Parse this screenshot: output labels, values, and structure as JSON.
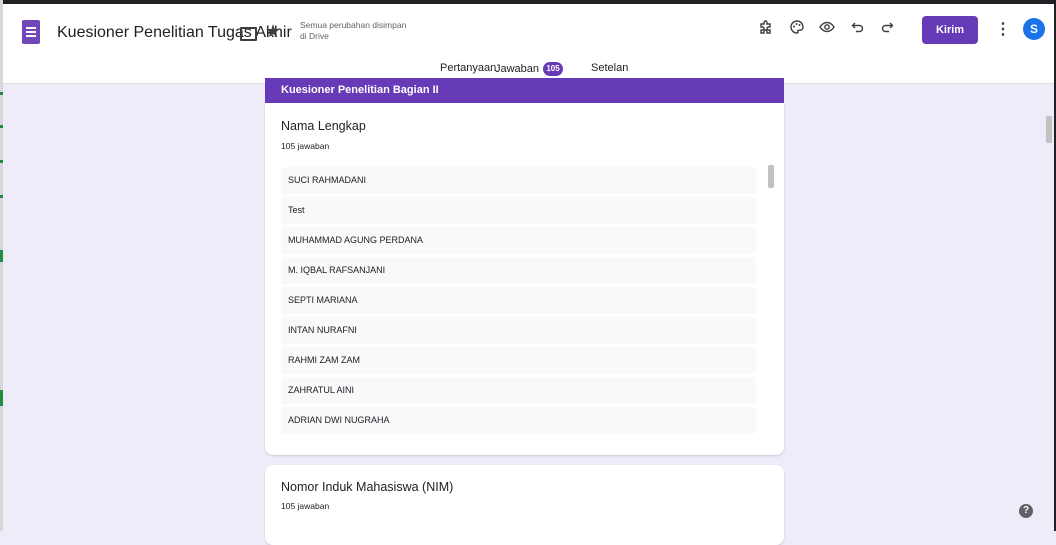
{
  "header": {
    "doc_title": "Kuesioner Penelitian Tugas Akhir",
    "save_status_line1": "Semua perubahan disimpan",
    "save_status_line2": "di Drive",
    "send_label": "Kirim",
    "avatar_initial": "S",
    "icons": [
      "forms-app-icon",
      "folder-icon",
      "star-icon",
      "addon-icon",
      "palette-icon",
      "preview-eye-icon",
      "undo-icon",
      "redo-icon",
      "more-vert-icon"
    ]
  },
  "tabs": {
    "questions": "Pertanyaan",
    "responses": "Jawaban",
    "responses_count": "105",
    "settings": "Setelan",
    "active": "Jawaban"
  },
  "section": {
    "title": "Kuesioner Penelitian Bagian II"
  },
  "questions": [
    {
      "title": "Nama Lengkap",
      "count": "105 jawaban",
      "answers": [
        "SUCI RAHMADANI",
        "Test",
        "MUHAMMAD AGUNG PERDANA",
        "M. IQBAL RAFSANJANI",
        "SEPTI MARIANA",
        "INTAN NURAFNI",
        "RAHMI ZAM ZAM",
        "ZAHRATUL AINI",
        "ADRIAN DWI NUGRAHA"
      ]
    },
    {
      "title": "Nomor Induk Mahasiswa (NIM)",
      "count": "105 jawaban"
    }
  ],
  "help": "?",
  "colors": {
    "accent": "#673ab7",
    "background": "#f0ebf8",
    "avatar": "#1a73e8"
  }
}
